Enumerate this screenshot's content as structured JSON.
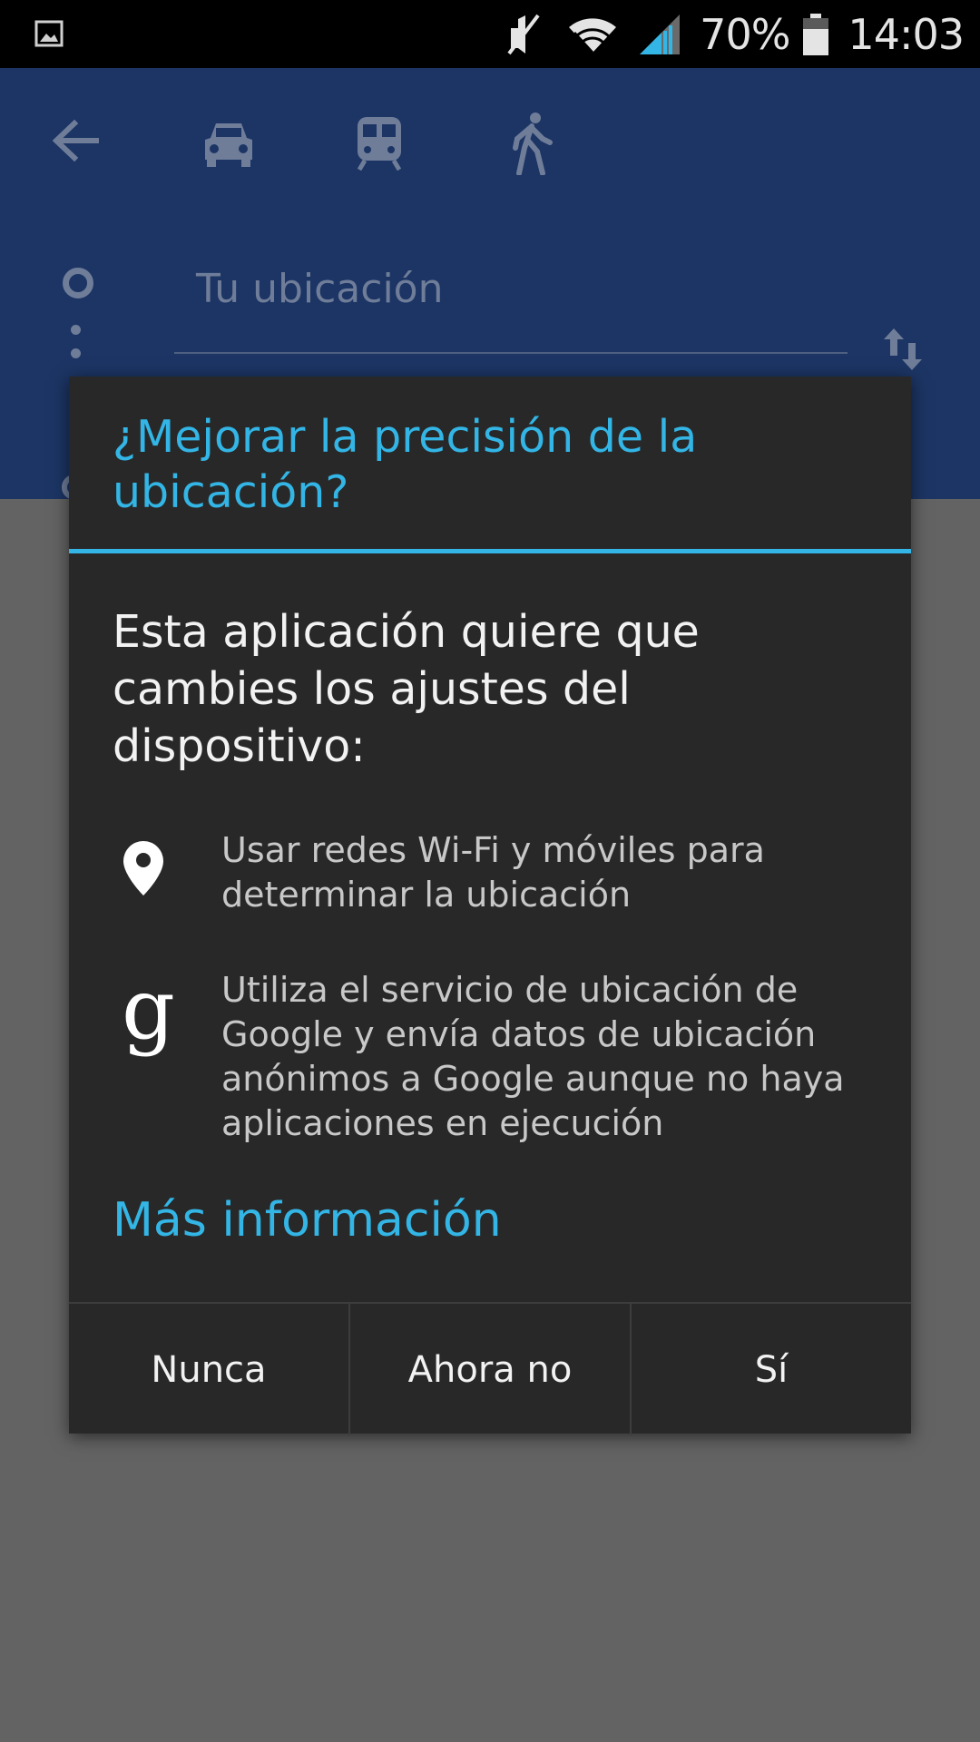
{
  "status_bar": {
    "battery_percent": "70%",
    "time": "14:03",
    "icons": [
      "image-notification-icon",
      "mute-icon",
      "wifi-icon",
      "signal-icon",
      "battery-icon"
    ]
  },
  "header": {
    "icons": [
      "back-arrow-icon",
      "car-icon",
      "transit-icon",
      "walk-icon",
      "swap-icon"
    ],
    "origin_text": "Tu ubicación"
  },
  "dialog": {
    "title": "¿Mejorar la precisión de la ubicación?",
    "message": "Esta aplicación quiere que cambies los ajustes del dispositivo:",
    "items": [
      {
        "icon": "location-pin-icon",
        "text": "Usar redes Wi-Fi y móviles para determinar la ubicación"
      },
      {
        "icon": "google-g-icon",
        "glyph": "g",
        "text": "Utiliza el servicio de ubicación de Google y envía datos de ubicación anónimos a Google aunque no haya aplicaciones en ejecución"
      }
    ],
    "more_info": "Más información",
    "buttons": {
      "never": "Nunca",
      "not_now": "Ahora no",
      "yes": "Sí"
    }
  },
  "colors": {
    "accent": "#33b5e5",
    "dialog_bg": "#282828",
    "header_bg": "#1c3564",
    "scrim": "#636363"
  }
}
